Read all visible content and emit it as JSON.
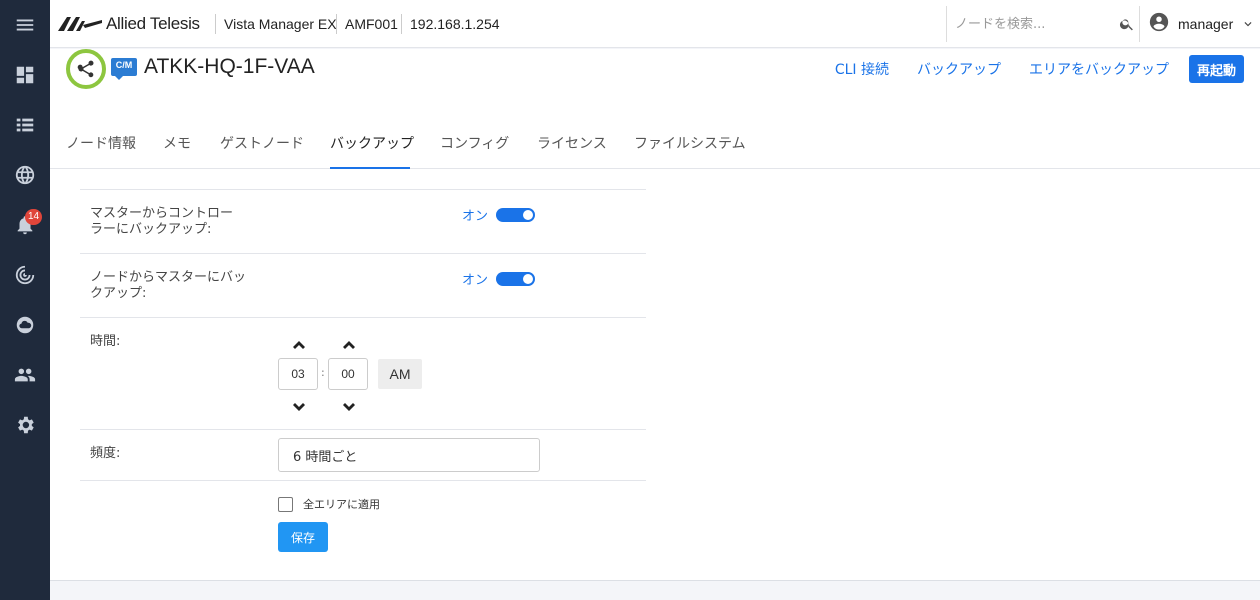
{
  "topbar": {
    "logo_text": "Allied Telesis",
    "app_name": "Vista Manager EX",
    "area": "AMF001",
    "ip": "192.168.1.254",
    "search_placeholder": "ノードを検索...",
    "username": "manager"
  },
  "sidebar": {
    "items": [
      {
        "icon": "menu-icon"
      },
      {
        "icon": "dashboard-icon"
      },
      {
        "icon": "list-icon"
      },
      {
        "icon": "globe-icon"
      },
      {
        "icon": "bell-icon",
        "badge": "14"
      },
      {
        "icon": "radar-icon"
      },
      {
        "icon": "cloud-icon"
      },
      {
        "icon": "users-icon"
      },
      {
        "icon": "gear-icon"
      }
    ]
  },
  "header": {
    "node_name": "ATKK-HQ-1F-VAA",
    "cm_label": "C/M",
    "links": [
      "CLI 接続",
      "バックアップ",
      "エリアをバックアップ"
    ],
    "reboot_label": "再起動"
  },
  "tabs": [
    {
      "label": "ノード情報",
      "active": false
    },
    {
      "label": "メモ",
      "active": false
    },
    {
      "label": "ゲストノード",
      "active": false
    },
    {
      "label": "バックアップ",
      "active": true
    },
    {
      "label": "コンフィグ",
      "active": false
    },
    {
      "label": "ライセンス",
      "active": false
    },
    {
      "label": "ファイルシステム",
      "active": false
    }
  ],
  "form": {
    "master_backup_label_1": "マスターからコントロー",
    "master_backup_label_2": "ラーにバックアップ:",
    "master_backup_state": "オン",
    "node_backup_label_1": "ノードからマスターにバッ",
    "node_backup_label_2": "クアップ:",
    "node_backup_state": "オン",
    "time_label": "時間:",
    "hour": "03",
    "minute": "00",
    "ampm": "AM",
    "frequency_label": "頻度:",
    "frequency_value": "6 時間ごと",
    "apply_all_label": "全エリアに適用",
    "save_label": "保存"
  },
  "colors": {
    "sidebar_bg": "#1f2a3c",
    "accent": "#1a73e8",
    "badge": "#e0453a",
    "node_ring": "#8dc63f"
  }
}
